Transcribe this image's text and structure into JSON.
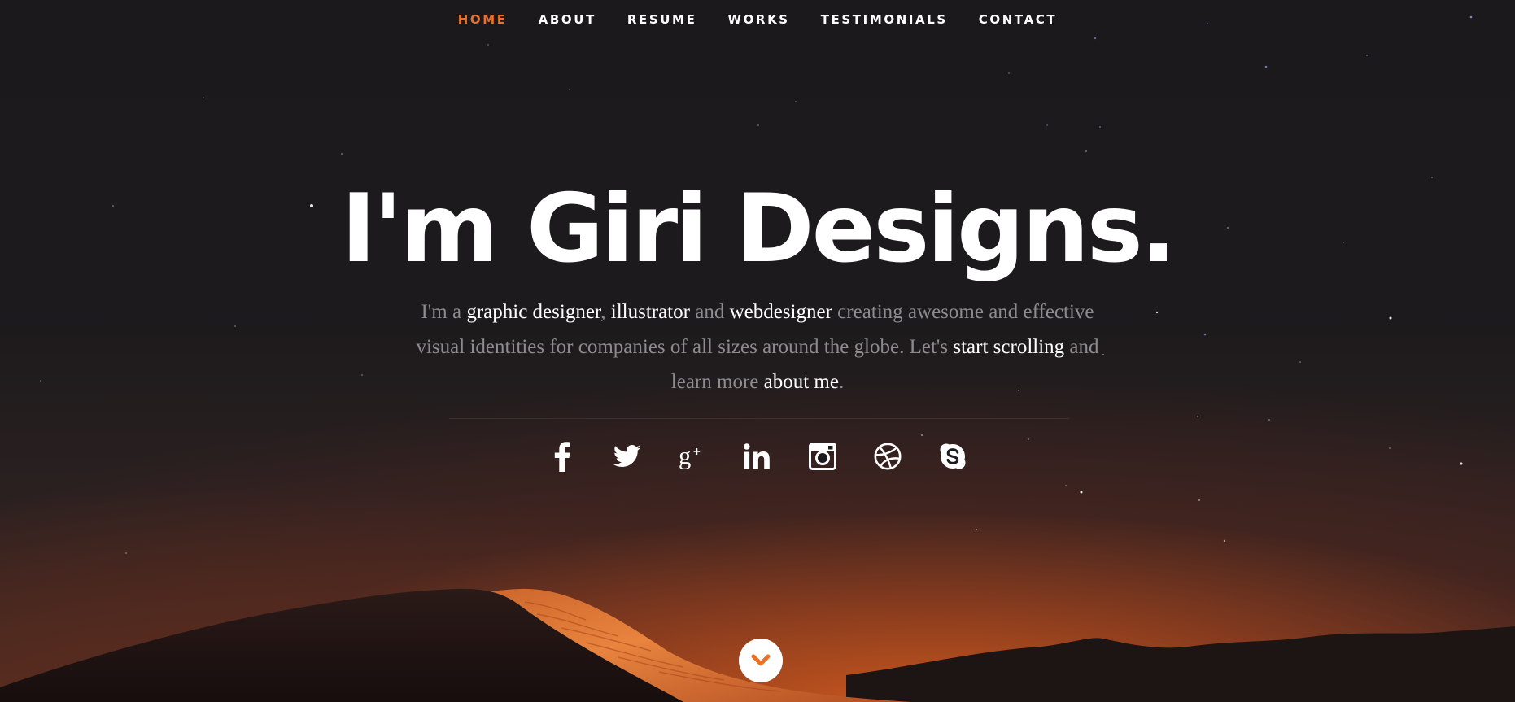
{
  "nav": {
    "items": [
      {
        "label": "HOME",
        "active": true
      },
      {
        "label": "ABOUT",
        "active": false
      },
      {
        "label": "RESUME",
        "active": false
      },
      {
        "label": "WORKS",
        "active": false
      },
      {
        "label": "TESTIMONIALS",
        "active": false
      },
      {
        "label": "CONTACT",
        "active": false
      }
    ]
  },
  "hero": {
    "headline": "I'm Giri Designs.",
    "intro": {
      "p1": "I'm a ",
      "h1": "graphic designer",
      "p2": ", ",
      "h2": "illustrator",
      "p3": " and ",
      "h3": "webdesigner",
      "p4": " creating awesome and effective visual identities for companies of all sizes around the globe. Let's ",
      "h4": "start scrolling",
      "p5": " and learn more ",
      "h5": "about me",
      "p6": "."
    }
  },
  "social": [
    {
      "icon": "facebook-icon"
    },
    {
      "icon": "twitter-icon"
    },
    {
      "icon": "google-plus-icon"
    },
    {
      "icon": "linkedin-icon"
    },
    {
      "icon": "instagram-icon"
    },
    {
      "icon": "dribbble-icon"
    },
    {
      "icon": "skype-icon"
    }
  ],
  "scroll": {
    "icon": "chevron-down-icon"
  },
  "colors": {
    "accent": "#e8722a",
    "background": "#1c1a1c",
    "text_muted": "#8d8b8e",
    "text_highlight": "#ffffff"
  }
}
